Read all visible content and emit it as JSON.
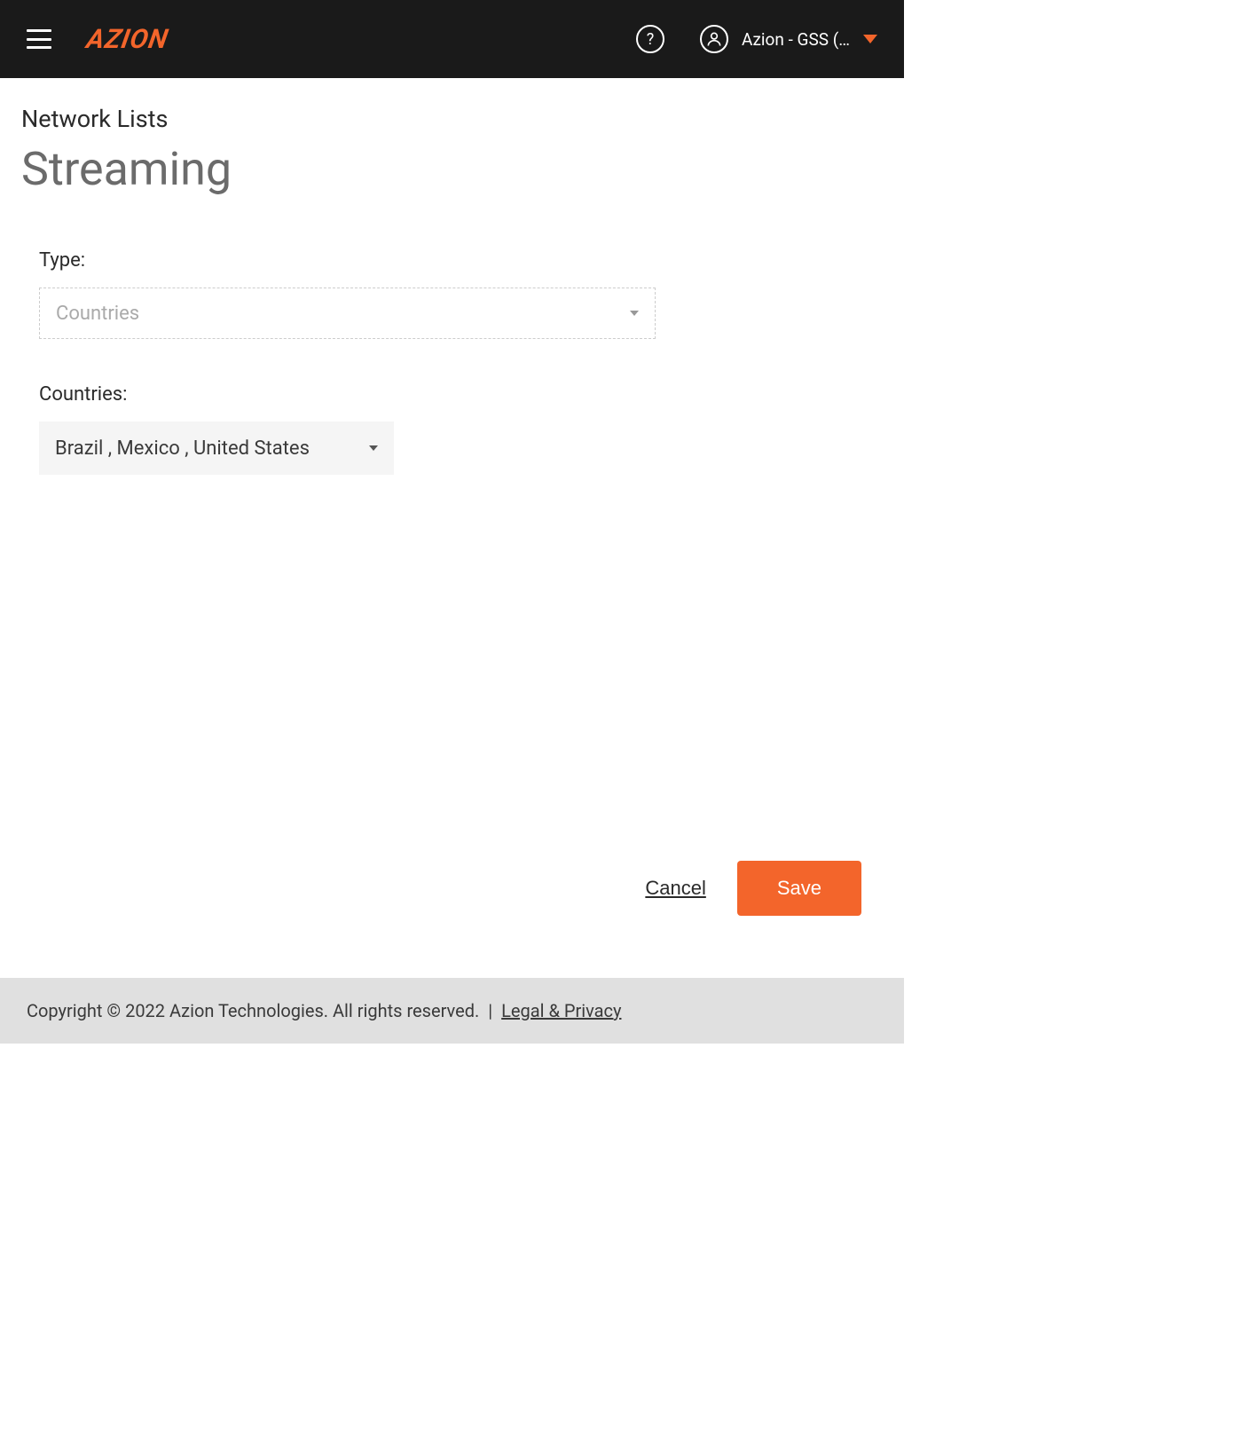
{
  "header": {
    "logo_text": "AZION",
    "help_symbol": "?",
    "account_name": "Azion - GSS (…"
  },
  "page": {
    "breadcrumb": "Network Lists",
    "title": "Streaming"
  },
  "form": {
    "type_label": "Type:",
    "type_value": "Countries",
    "countries_label": "Countries:",
    "countries_value": "Brazil , Mexico , United States"
  },
  "actions": {
    "cancel_label": "Cancel",
    "save_label": "Save"
  },
  "footer": {
    "copyright": "Copyright © 2022 Azion Technologies. All rights reserved.",
    "divider": "  |  ",
    "legal_link": "Legal & Privacy"
  }
}
